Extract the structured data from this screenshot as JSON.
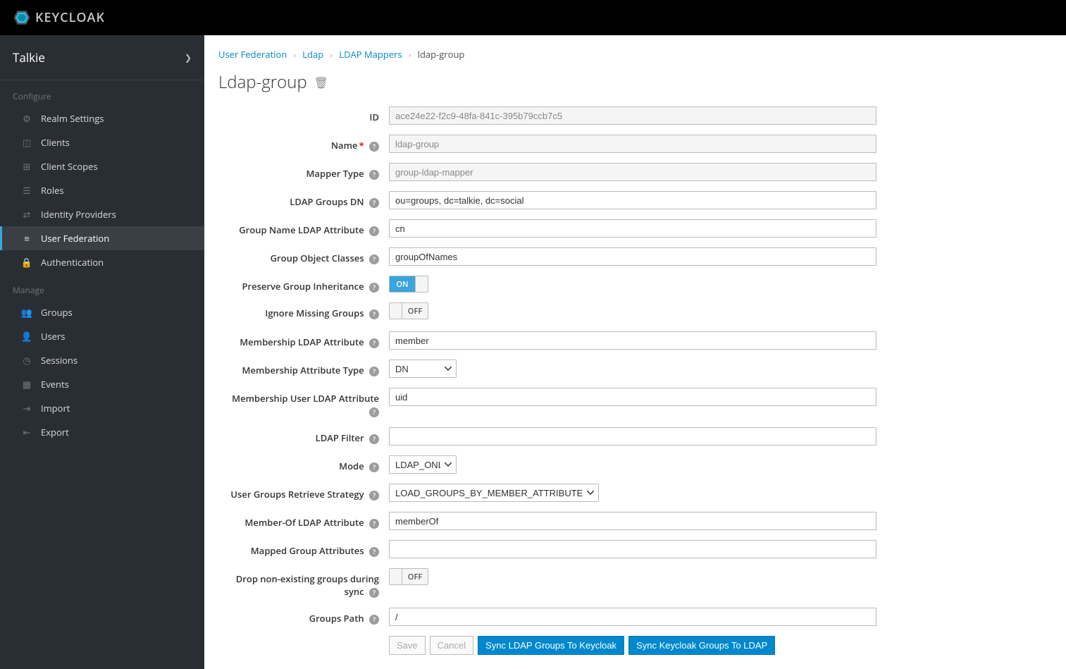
{
  "header": {
    "brand": "KEYCLOAK"
  },
  "realm": {
    "name": "Talkie"
  },
  "sidebar": {
    "configure_label": "Configure",
    "manage_label": "Manage",
    "configure": [
      {
        "label": "Realm Settings"
      },
      {
        "label": "Clients"
      },
      {
        "label": "Client Scopes"
      },
      {
        "label": "Roles"
      },
      {
        "label": "Identity Providers"
      },
      {
        "label": "User Federation"
      },
      {
        "label": "Authentication"
      }
    ],
    "manage": [
      {
        "label": "Groups"
      },
      {
        "label": "Users"
      },
      {
        "label": "Sessions"
      },
      {
        "label": "Events"
      },
      {
        "label": "Import"
      },
      {
        "label": "Export"
      }
    ]
  },
  "breadcrumb": {
    "items": [
      "User Federation",
      "Ldap",
      "LDAP Mappers"
    ],
    "current": "ldap-group"
  },
  "page": {
    "title": "Ldap-group"
  },
  "form": {
    "id_label": "ID",
    "id_value": "ace24e22-f2c9-48fa-841c-395b79ccb7c5",
    "name_label": "Name",
    "name_value": "ldap-group",
    "mapper_type_label": "Mapper Type",
    "mapper_type_value": "group-ldap-mapper",
    "ldap_groups_dn_label": "LDAP Groups DN",
    "ldap_groups_dn_value": "ou=groups, dc=talkie, dc=social",
    "group_name_attr_label": "Group Name LDAP Attribute",
    "group_name_attr_value": "cn",
    "group_obj_classes_label": "Group Object Classes",
    "group_obj_classes_value": "groupOfNames",
    "preserve_inherit_label": "Preserve Group Inheritance",
    "ignore_missing_label": "Ignore Missing Groups",
    "membership_attr_label": "Membership LDAP Attribute",
    "membership_attr_value": "member",
    "membership_type_label": "Membership Attribute Type",
    "membership_type_value": "DN",
    "membership_user_attr_label": "Membership User LDAP Attribute",
    "membership_user_attr_value": "uid",
    "ldap_filter_label": "LDAP Filter",
    "ldap_filter_value": "",
    "mode_label": "Mode",
    "mode_value": "LDAP_ONLY",
    "retrieve_strategy_label": "User Groups Retrieve Strategy",
    "retrieve_strategy_value": "LOAD_GROUPS_BY_MEMBER_ATTRIBUTE",
    "memberof_attr_label": "Member-Of LDAP Attribute",
    "memberof_attr_value": "memberOf",
    "mapped_attrs_label": "Mapped Group Attributes",
    "mapped_attrs_value": "",
    "drop_nonexist_label": "Drop non-existing groups during sync",
    "groups_path_label": "Groups Path",
    "groups_path_value": "/",
    "toggle_on": "ON",
    "toggle_off": "OFF"
  },
  "buttons": {
    "save": "Save",
    "cancel": "Cancel",
    "sync_to_keycloak": "Sync LDAP Groups To Keycloak",
    "sync_to_ldap": "Sync Keycloak Groups To LDAP"
  }
}
